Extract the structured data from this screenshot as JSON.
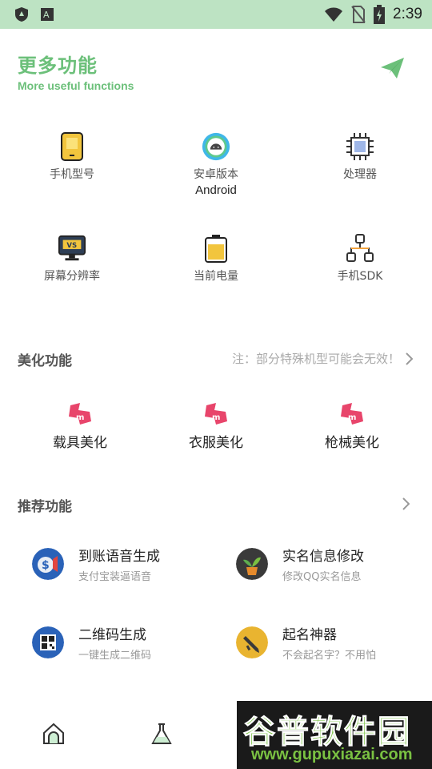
{
  "status_bar": {
    "time": "2:39"
  },
  "header": {
    "title": "更多功能",
    "subtitle": "More useful functions"
  },
  "device_info": [
    {
      "label": "手机型号",
      "value": "",
      "icon": "phone-icon"
    },
    {
      "label": "安卓版本",
      "value": "Android",
      "icon": "android-icon"
    },
    {
      "label": "处理器",
      "value": "",
      "icon": "cpu-icon"
    },
    {
      "label": "屏幕分辨率",
      "value": "",
      "icon": "monitor-icon"
    },
    {
      "label": "当前电量",
      "value": "",
      "icon": "battery-icon"
    },
    {
      "label": "手机SDK",
      "value": "",
      "icon": "sdk-icon"
    }
  ],
  "beauty_section": {
    "title": "美化功能",
    "note": "注：部分特殊机型可能会无效！",
    "items": [
      {
        "label": "载具美化",
        "icon": "ribbon-m-icon"
      },
      {
        "label": "衣服美化",
        "icon": "ribbon-m-icon"
      },
      {
        "label": "枪械美化",
        "icon": "ribbon-m-icon"
      }
    ]
  },
  "recommend_section": {
    "title": "推荐功能",
    "items": [
      {
        "title": "到账语音生成",
        "subtitle": "支付宝装逼语音",
        "icon": "coin-speaker-icon",
        "color": "#2a62b8"
      },
      {
        "title": "实名信息修改",
        "subtitle": "修改QQ实名信息",
        "icon": "plant-icon",
        "color": "#3a3a3a"
      },
      {
        "title": "二维码生成",
        "subtitle": "一键生成二维码",
        "icon": "qr-icon",
        "color": "#2a62b8"
      },
      {
        "title": "起名神器",
        "subtitle": "不会起名字？不用怕",
        "icon": "pen-icon",
        "color": "#e9b430"
      }
    ]
  },
  "watermark": {
    "text": "谷普软件园",
    "url": "www.gupuxiazai.com"
  },
  "colors": {
    "accent": "#6cc07a",
    "status_bar": "#bde3c3"
  }
}
